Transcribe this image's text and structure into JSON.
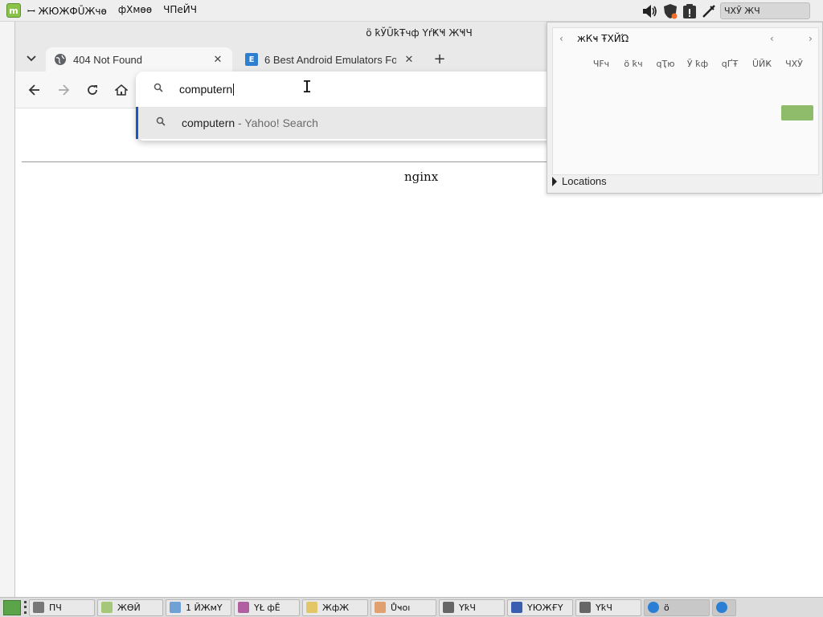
{
  "top_panel": {
    "menu_items": [
      "ꟷ ЖЮЖФŪЖчө",
      "фХмөө",
      "ЧПеЙЧ"
    ],
    "clock": "ЧХЎ ЖЧ"
  },
  "browser": {
    "window_title": "ö ҟЎŪҟŦчф  ΥŕҜҸ ЖҸЧ",
    "tabs": [
      {
        "title": "404 Not Found",
        "favicon": "globe-icon"
      },
      {
        "title": "6 Best Android Emulators Fo",
        "favicon": "site-icon"
      }
    ],
    "omnibox": {
      "input_value": "computern",
      "suggestion_main": "computern",
      "suggestion_sub": " - Yahoo! Search"
    },
    "page": {
      "footer_text": "nginx"
    }
  },
  "calendar": {
    "month_label": "жКҹ ŦXЙΏ",
    "weekdays": [
      "ЧFч",
      "ö ҟч",
      "qҬю",
      "Ў ҟф",
      "qҐŦ",
      "ŪЙҜ",
      "ЧХЎ"
    ],
    "locations_label": "Locations"
  },
  "taskbar": {
    "items": [
      {
        "label": "ПЧ",
        "color": "#777777"
      },
      {
        "label": "ЖӨЙ",
        "color": "#a5c878"
      },
      {
        "label": "1 ЙЖмҮ",
        "color": "#6fa0d6"
      },
      {
        "label": "ΥŁ фĒ",
        "color": "#b05fa0"
      },
      {
        "label": "ЖфЖ",
        "color": "#e3c766"
      },
      {
        "label": "Ůҹоı",
        "color": "#e0a070"
      },
      {
        "label": "ΥҟЧ",
        "color": "#666666"
      },
      {
        "label": "ΥЮЖҒΥ",
        "color": "#3b5fb0"
      },
      {
        "label": "ΥҟЧ",
        "color": "#666666"
      },
      {
        "label": "ö",
        "color": "#2a7fd4"
      },
      {
        "label": "",
        "color": "#2a7fd4"
      }
    ]
  }
}
